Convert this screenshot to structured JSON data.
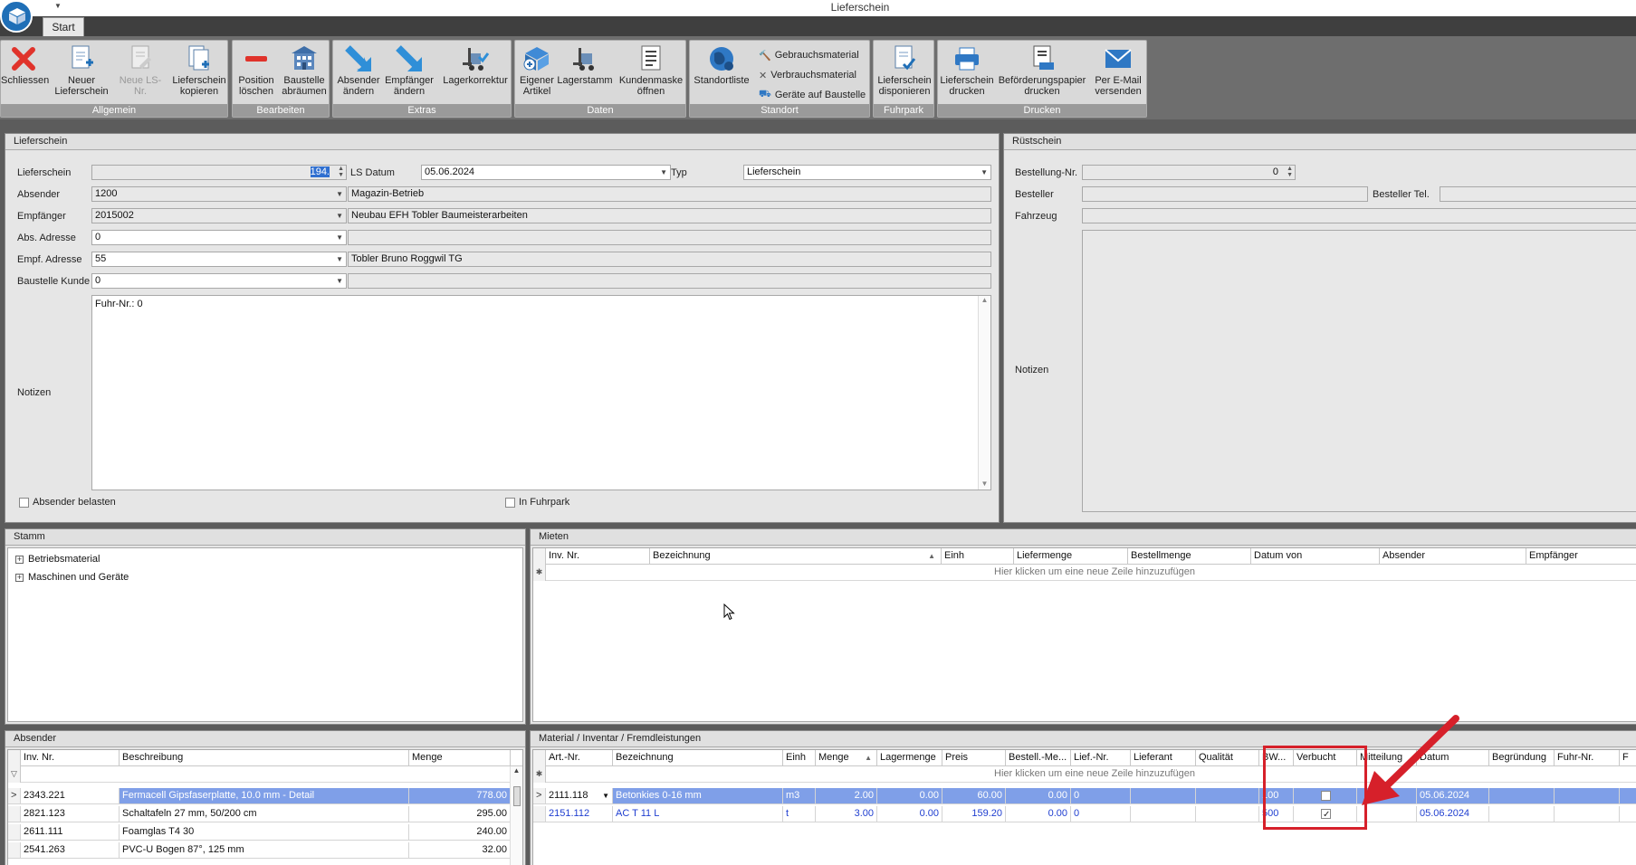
{
  "window": {
    "title": "Lieferschein"
  },
  "tabs": [
    {
      "label": "Start"
    }
  ],
  "ribbon": {
    "groups": {
      "allgemein": "Allgemein",
      "bearbeiten": "Bearbeiten",
      "extras": "Extras",
      "daten": "Daten",
      "standort": "Standort",
      "fuhrpark": "Fuhrpark",
      "drucken": "Drucken"
    },
    "buttons": {
      "schliessen": "Schliessen",
      "neuer_lieferschein_1": "Neuer",
      "neuer_lieferschein_2": "Lieferschein",
      "neue_ls_nr": "Neue LS-Nr.",
      "ls_kopieren_1": "Lieferschein",
      "ls_kopieren_2": "kopieren",
      "pos_loeschen_1": "Position",
      "pos_loeschen_2": "löschen",
      "baustelle_1": "Baustelle",
      "baustelle_2": "abräumen",
      "absender_1": "Absender",
      "absender_2": "ändern",
      "empfaenger_1": "Empfänger",
      "empfaenger_2": "ändern",
      "lagerkorrektur": "Lagerkorrektur",
      "eigener_1": "Eigener",
      "eigener_2": "Artikel",
      "lagerstamm": "Lagerstamm",
      "kundenmaske_1": "Kundenmaske",
      "kundenmaske_2": "öffnen",
      "standortliste": "Standortliste",
      "gebrauchsmaterial": "Gebrauchsmaterial",
      "verbrauchsmaterial": "Verbrauchsmaterial",
      "geraete": "Geräte auf Baustelle",
      "disponieren_1": "Lieferschein",
      "disponieren_2": "disponieren",
      "ls_drucken_1": "Lieferschein",
      "ls_drucken_2": "drucken",
      "befoerderung_1": "Beförderungspapier",
      "befoerderung_2": "drucken",
      "email_1": "Per E-Mail",
      "email_2": "versenden"
    }
  },
  "lieferschein": {
    "header": "Lieferschein",
    "labels": {
      "lieferschein": "Lieferschein",
      "ls_datum": "LS Datum",
      "typ": "Typ",
      "absender": "Absender",
      "empfaenger": "Empfänger",
      "abs_adresse": "Abs. Adresse",
      "empf_adresse": "Empf. Adresse",
      "baustelle_kunde": "Baustelle Kunde",
      "notizen": "Notizen",
      "absender_belasten": "Absender belasten",
      "in_fuhrpark": "In Fuhrpark"
    },
    "values": {
      "lieferschein_nr": "194.",
      "ls_datum": "05.06.2024",
      "typ": "Lieferschein",
      "absender": "1200",
      "absender_name": "Magazin-Betrieb",
      "empfaenger": "2015002",
      "empfaenger_name": "Neubau EFH Tobler Baumeisterarbeiten",
      "abs_adresse": "0",
      "abs_adresse_name": "",
      "empf_adresse": "55",
      "empf_adresse_name": "Tobler Bruno Roggwil TG",
      "baustelle_kunde": "0",
      "baustelle_kunde_name": "",
      "notizen": "Fuhr-Nr.: 0",
      "absender_belasten": false,
      "in_fuhrpark": false
    }
  },
  "ruestschein": {
    "header": "Rüstschein",
    "labels": {
      "bestellung_nr": "Bestellung-Nr.",
      "besteller": "Besteller",
      "besteller_tel": "Besteller Tel.",
      "fahrzeug": "Fahrzeug",
      "notizen": "Notizen"
    },
    "values": {
      "bestellung_nr": "0",
      "besteller": "",
      "besteller_tel": "",
      "fahrzeug": ""
    }
  },
  "stamm": {
    "header": "Stamm",
    "items": [
      {
        "label": "Betriebsmaterial"
      },
      {
        "label": "Maschinen und Geräte"
      }
    ]
  },
  "mieten": {
    "header": "Mieten",
    "columns": [
      "Inv. Nr.",
      "Bezeichnung",
      "Einh",
      "Liefermenge",
      "Bestellmenge",
      "Datum von",
      "Absender",
      "Empfänger"
    ],
    "new_row_hint": "Hier klicken um eine neue Zeile hinzuzufügen"
  },
  "absender_grid": {
    "header": "Absender",
    "columns": [
      "Inv. Nr.",
      "Beschreibung",
      "Menge"
    ],
    "rows": [
      {
        "inv": "2343.221",
        "desc": "Fermacell Gipsfaserplatte, 10.0 mm - Detail",
        "menge": "778.00"
      },
      {
        "inv": "2821.123",
        "desc": "Schaltafeln 27 mm, 50/200 cm",
        "menge": "295.00"
      },
      {
        "inv": "2611.111",
        "desc": "Foamglas T4   30",
        "menge": "240.00"
      },
      {
        "inv": "2541.263",
        "desc": "PVC-U Bogen 87°, 125 mm",
        "menge": "32.00"
      }
    ]
  },
  "material": {
    "header": "Material / Inventar / Fremdleistungen",
    "columns": [
      "Art.-Nr.",
      "Bezeichnung",
      "Einh",
      "Menge",
      "Lagermenge",
      "Preis",
      "Bestell.-Me...",
      "Lief.-Nr.",
      "Lieferant",
      "Qualität",
      "BW...",
      "Verbucht",
      "Mitteilung",
      "Datum",
      "Begründung",
      "Fuhr-Nr.",
      "F"
    ],
    "new_row_hint": "Hier klicken um eine neue Zeile hinzuzufügen",
    "rows": [
      {
        "art": "2111.118",
        "bez": "Betonkies 0-16 mm",
        "einh": "m3",
        "menge": "2.00",
        "lager": "0.00",
        "preis": "60.00",
        "bestell": "0.00",
        "lief": "0",
        "lieferant": "",
        "qual": "",
        "bw": "100",
        "verbucht": false,
        "mitt": "",
        "datum": "05.06.2024",
        "begr": "",
        "fuhr": ""
      },
      {
        "art": "2151.112",
        "bez": "AC T 11 L",
        "einh": "t",
        "menge": "3.00",
        "lager": "0.00",
        "preis": "159.20",
        "bestell": "0.00",
        "lief": "0",
        "lieferant": "",
        "qual": "",
        "bw": "500",
        "verbucht": true,
        "mitt": "",
        "datum": "05.06.2024",
        "begr": "",
        "fuhr": ""
      }
    ]
  },
  "colors": {
    "accent_blue": "#1f6fb7",
    "selected_row": "#7f9fe8",
    "highlight_red": "#d6202a"
  }
}
